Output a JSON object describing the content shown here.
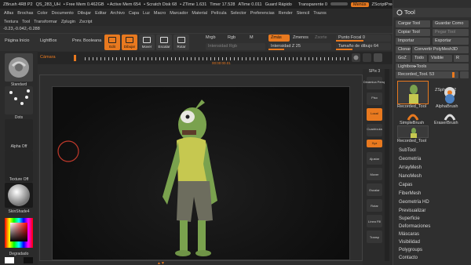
{
  "topbar": {
    "items": [
      "ZBrush 4R8 P2",
      "QS_283_UH",
      "• Free Mem 0.462GB",
      "• Active Mem 654",
      "• Scratch Disk 68",
      "• ZTime 1.631",
      "Timer 17.528",
      "ATime 0.011",
      "Guard Rápido"
    ],
    "transparency": "Transparente 0",
    "menus": "Menús",
    "script": "ZScriptPred"
  },
  "menubar": {
    "row1": [
      "Alfas",
      "Brochas",
      "Color",
      "Documento",
      "Dibujar",
      "Editar",
      "Archivo",
      "Capa",
      "Luz",
      "Macro",
      "Marcador",
      "Material",
      "Película",
      "Selector",
      "Preferencias",
      "Render",
      "Stencil",
      "Trazos"
    ],
    "row2": [
      "Textura",
      "Tool",
      "Transformar",
      "Zplugin",
      "Zscript"
    ]
  },
  "coords": "-0.23,-0.042,-0.288",
  "shelf": {
    "pagina_inicio": "Página Inicio",
    "lightbox": "LightBox",
    "prev_booleana": "Prev. Booleana",
    "edit": "Edit",
    "dibujar": "Dibujar",
    "mover": "Mover",
    "escalar": "Escalar",
    "rotar": "Rotar",
    "mrgb": "Mrgb",
    "rgb": "Rgb",
    "m": "M",
    "intensidad_rgb": "Intensidad Rgb",
    "zmas": "Zmás",
    "zmenos": "Zmenos",
    "zsorte": "Zsorte",
    "intensidad_z": "Intensidad Z 25",
    "punto_focal": "Punto Focal 0",
    "tamano_dibujo": "Tamaño de dibujo 64"
  },
  "timeline": {
    "label": "Cámara",
    "center": "00:00:00.01"
  },
  "lefttray": {
    "standard": "Standard",
    "dots": "Dots",
    "alpha_off": "Alpha Off",
    "texture_off": "Texture Off",
    "skinshade": "SkinShade4",
    "degradado": "Degradado",
    "switch_color": "SwitchColor"
  },
  "righttray": {
    "spix": "SPix 3",
    "buttons": [
      "Dinámica Persp",
      "Piso",
      "Local",
      "Cuadrícula",
      "Xyz",
      "Ajustar",
      "Mover",
      "Escalar",
      "Rotar",
      "Línea Fill",
      "Transp"
    ]
  },
  "toolpanel": {
    "title": "Tool",
    "cargar": "Cargar Tool",
    "guardar": "Guardar Como",
    "copiar": "Copiar Tool",
    "pegar": "Pegar Tool",
    "importar": "Importar",
    "exportar": "Exportar",
    "clonar": "Clonar",
    "convertir": "Convertir PolyMesh3D",
    "goz": "GoZ",
    "todo": "Todo",
    "visible": "Visible",
    "r": "R",
    "lightbox_tools": "Lightbox▸Tools",
    "recorded": "Recorded_Tool. 53",
    "thumbs": [
      "Recorded_Tool",
      "ZSphere_2",
      "AlphaBrush",
      "SimpleBrush",
      "EraserBrush",
      "Recorded_Tool"
    ],
    "subpalettes": [
      "SubTool",
      "Geometría",
      "ArrayMesh",
      "NanoMesh",
      "Capas",
      "FiberMesh",
      "Geometría HD",
      "Previsualizar",
      "Superficie",
      "Deformaciones",
      "Máscaras",
      "Visibilidad",
      "Polygroups",
      "Contacto"
    ]
  },
  "colors": {
    "accent": "#e8791f",
    "bg": "#2e2e2e"
  }
}
